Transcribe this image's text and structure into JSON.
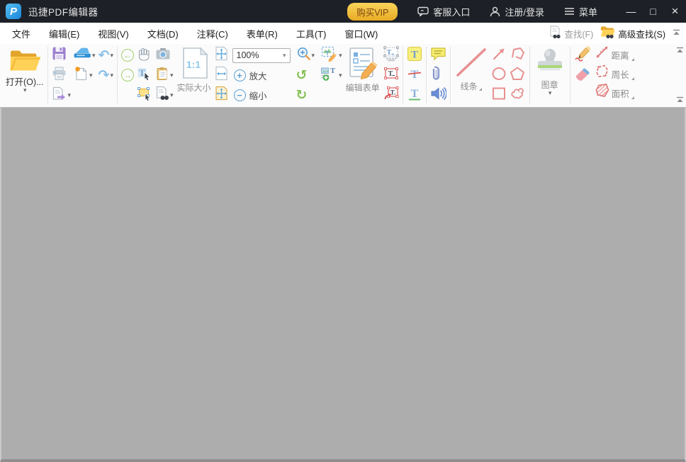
{
  "titlebar": {
    "title": "迅捷PDF编辑器",
    "vip_button": "购买VIP",
    "support": "客服入口",
    "login": "注册/登录",
    "menu": "菜单"
  },
  "menubar": {
    "items": [
      {
        "label": "文件"
      },
      {
        "label": "编辑(E)"
      },
      {
        "label": "视图(V)"
      },
      {
        "label": "文档(D)"
      },
      {
        "label": "注释(C)"
      },
      {
        "label": "表单(R)"
      },
      {
        "label": "工具(T)"
      },
      {
        "label": "窗口(W)"
      }
    ],
    "find": "查找(F)",
    "advanced_find": "高级查找(S)"
  },
  "toolbar": {
    "open_label": "打开(O)...",
    "actual_size_label": "实际大小",
    "zoom_value": "100%",
    "zoom_in_label": "放大",
    "zoom_out_label": "缩小",
    "edit_form_label": "编辑表单",
    "line_label": "线条",
    "stamp_label": "图章",
    "distance_label": "距离",
    "perimeter_label": "周长",
    "area_label": "面积"
  },
  "icons": {
    "caret_down": "▾",
    "undo": "↶",
    "redo": "↷",
    "back": "←",
    "forward": "→",
    "rotate_ccw": "↺",
    "rotate_cw": "↻",
    "plus": "+",
    "minus": "−",
    "minimize": "—",
    "maximize": "□",
    "close": "×"
  },
  "colors": {
    "titlebar_bg": "#1d2127",
    "vip_gold": "#f2c03c",
    "accent_blue": "#2aa0dc",
    "shape_red": "#e89090",
    "canvas_gray": "#adadad"
  }
}
